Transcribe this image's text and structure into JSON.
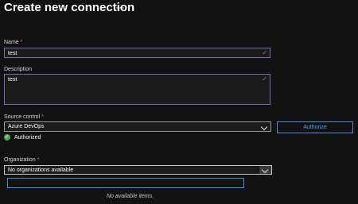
{
  "title": "Create new connection",
  "more_label": "···",
  "name": {
    "label": "Name",
    "required": "*",
    "value": "test"
  },
  "description": {
    "label": "Description",
    "value": "test"
  },
  "source_control": {
    "label": "Source control",
    "required": "*",
    "value": "Azure DevOps"
  },
  "authorize_button": "Authorize",
  "auth_status": "Authorized",
  "organization": {
    "label": "Organization",
    "required": "*",
    "value": "No organizations available"
  },
  "filter_placeholder": "",
  "empty_text": "No available items.",
  "colors": {
    "accent": "#8a63b8",
    "link": "#4ea1ff",
    "success": "#5aa454",
    "required": "#f1707b"
  },
  "icons": [
    "more-icon",
    "checkmark-icon",
    "chevron-down-icon",
    "success-check-icon"
  ]
}
